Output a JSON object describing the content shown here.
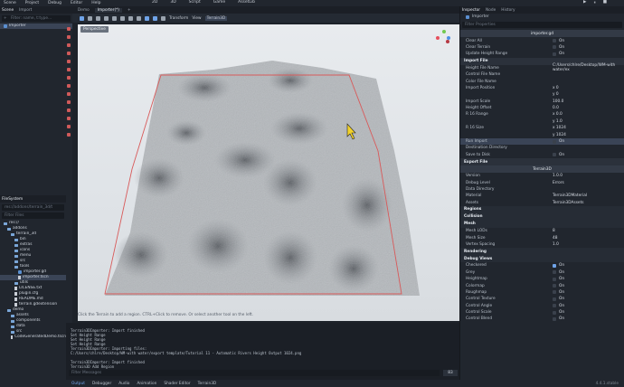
{
  "menu": [
    "Scene",
    "Project",
    "Debug",
    "Editor",
    "Help"
  ],
  "main_screens": [
    "2D",
    "3D",
    "Script",
    "Game",
    "AssetLib"
  ],
  "left_dock": {
    "scene_tabs": [
      "Scene",
      "Import"
    ],
    "scene_filter": "Filter: name, t:type...",
    "scene_root": "Importer",
    "fs_tab": "FileSystem",
    "fs_path": "res://addons/terrain_3d/t",
    "fs_filter": "Filter Files",
    "tree": [
      {
        "label": "res://",
        "kind": "folder",
        "indent": 1
      },
      {
        "label": "addons",
        "kind": "folder",
        "indent": 2
      },
      {
        "label": "terrain_3d",
        "kind": "folder",
        "indent": 3
      },
      {
        "label": "bin",
        "kind": "folder",
        "indent": 4
      },
      {
        "label": "extras",
        "kind": "folder",
        "indent": 4
      },
      {
        "label": "icons",
        "kind": "folder",
        "indent": 4
      },
      {
        "label": "menu",
        "kind": "folder",
        "indent": 4
      },
      {
        "label": "src",
        "kind": "folder",
        "indent": 4
      },
      {
        "label": "tools",
        "kind": "folder",
        "indent": 4
      },
      {
        "label": "importer.gd",
        "kind": "gd",
        "indent": 5
      },
      {
        "label": "importer.tscn",
        "kind": "file",
        "indent": 5,
        "selected": true
      },
      {
        "label": "utils",
        "kind": "folder",
        "indent": 4
      },
      {
        "label": "LICENSE.txt",
        "kind": "file",
        "indent": 4
      },
      {
        "label": "plugin.cfg",
        "kind": "file",
        "indent": 4
      },
      {
        "label": "README.md",
        "kind": "file",
        "indent": 4
      },
      {
        "label": "terrain.gdextension",
        "kind": "file",
        "indent": 4
      },
      {
        "label": "demo",
        "kind": "folder",
        "indent": 2
      },
      {
        "label": "assets",
        "kind": "folder",
        "indent": 3
      },
      {
        "label": "components",
        "kind": "folder",
        "indent": 3
      },
      {
        "label": "data",
        "kind": "folder",
        "indent": 3
      },
      {
        "label": "src",
        "kind": "folder",
        "indent": 3
      },
      {
        "label": "CodeGeneratedDemo.tscn",
        "kind": "file",
        "indent": 3
      }
    ]
  },
  "viewport": {
    "tabs": [
      "Demo",
      "Importer(*)"
    ],
    "toolbar_labels": [
      "Transform",
      "View",
      "Terrain3D"
    ],
    "perspective": "Perspective",
    "hint": "Click the Terrain to add a region. CTRL+Click to remove. Or select another tool on the left."
  },
  "output": {
    "lines": [
      "Terrain3DImporter: Import finished",
      "Set Height Range",
      "Set Height Range",
      "Set Height Range",
      "Terrain3DImporter: Importing files:",
      "    C:/Users/chlre/Desktop/WM-with water/export template/Tutorial 11 - Automatic Rivers Height Output 1024.png",
      "",
      "Terrain3DImporter: Import finished",
      "Terrain3D Add Region"
    ],
    "filter": "Filter Messages",
    "count": "83"
  },
  "bottom_tabs": [
    "Output",
    "Debugger",
    "Audio",
    "Animation",
    "Shader Editor",
    "Terrain3D"
  ],
  "version": "4.4.1.stable",
  "inspector": {
    "tabs": [
      "Inspector",
      "Node",
      "History"
    ],
    "node": "Importer",
    "filter": "Filter Properties",
    "script": "importer.gd",
    "rows_top": [
      {
        "label": "Clear All",
        "val": "On"
      },
      {
        "label": "Clear Terrain",
        "val": "On"
      },
      {
        "label": "Update Height Range",
        "val": "On"
      }
    ],
    "import_file_section": "Import File",
    "import_rows": [
      {
        "label": "Height File Name",
        "val": "C:/Users/chlre/Desktop/WM-with water/ex"
      },
      {
        "label": "Control File Name",
        "val": ""
      },
      {
        "label": "Color File Name",
        "val": ""
      },
      {
        "label": "Import Position",
        "val": "x  0"
      },
      {
        "label": "",
        "val": "y  0"
      },
      {
        "label": "Import Scale",
        "val": "100.0"
      },
      {
        "label": "Height Offset",
        "val": "0.0"
      },
      {
        "label": "R 16 Range",
        "val": "x  0.0"
      },
      {
        "label": "",
        "val": "y  1.0"
      },
      {
        "label": "R 16 Size",
        "val": "x  1024"
      },
      {
        "label": "",
        "val": "y  1024"
      },
      {
        "label": "Run Import",
        "val": "On"
      },
      {
        "label": "Destination Directory",
        "val": ""
      },
      {
        "label": "Save to Disk",
        "val": "On"
      }
    ],
    "export_file_section": "Export File",
    "terrain3d": "Terrain3D",
    "t3d_rows": [
      {
        "label": "Version",
        "val": "1.0.0"
      },
      {
        "label": "Debug Level",
        "val": "Errors"
      },
      {
        "label": "Data Directory",
        "val": ""
      },
      {
        "label": "Material",
        "val": "Terrain3DMaterial"
      },
      {
        "label": "Assets",
        "val": "Terrain3DAssets"
      }
    ],
    "subsections": [
      "Regions",
      "Collision",
      "Mesh",
      "Rendering",
      "Debug Views"
    ],
    "mesh_rows": [
      {
        "label": "Mesh LODs",
        "val": "8"
      },
      {
        "label": "Mesh Size",
        "val": "48"
      },
      {
        "label": "Vertex Spacing",
        "val": "1.0"
      }
    ],
    "debug_rows": [
      {
        "label": "Checkered",
        "val": "On"
      },
      {
        "label": "Grey",
        "val": "On"
      },
      {
        "label": "Heightmap",
        "val": "On"
      },
      {
        "label": "Colormap",
        "val": "On"
      },
      {
        "label": "Roughmap",
        "val": "On"
      },
      {
        "label": "Control Texture",
        "val": "On"
      },
      {
        "label": "Control Angle",
        "val": "On"
      },
      {
        "label": "Control Scale",
        "val": "On"
      },
      {
        "label": "Control Blend",
        "val": "On"
      }
    ]
  }
}
